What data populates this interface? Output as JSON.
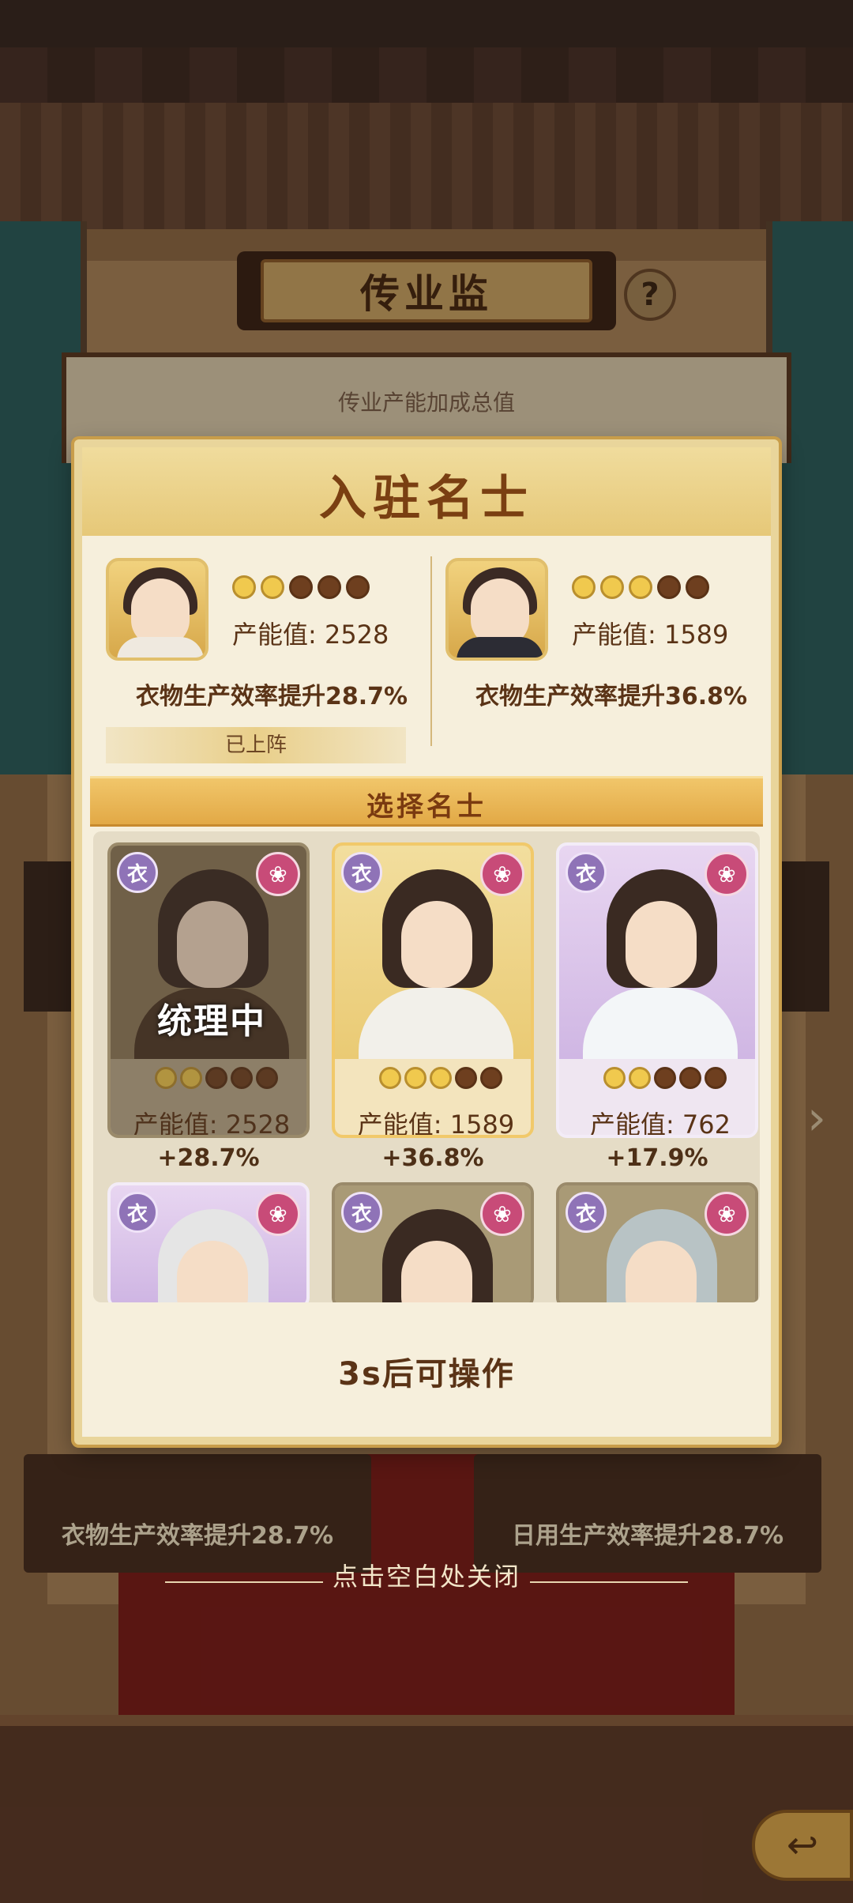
{
  "background": {
    "hall_title": "传业监",
    "help_label": "?",
    "panel_text": "传业产能加成总值",
    "bottom_left_text": "衣物生产效率提升28.7%",
    "bottom_right_text": "日用生产效率提升28.7%",
    "close_hint": "点击空白处关闭",
    "back_icon": "back-arrow-icon"
  },
  "modal": {
    "title": "入驻名士",
    "slots": [
      {
        "stars_on": 2,
        "stars_total": 5,
        "power": "产能值: 2528",
        "boost": "衣物生产效率提升28.7%",
        "status": "已上阵"
      },
      {
        "stars_on": 3,
        "stars_total": 5,
        "power": "产能值: 1589",
        "boost": "衣物生产效率提升36.8%"
      }
    ],
    "select_title": "选择名士",
    "cards": [
      {
        "type_tag": "衣",
        "stars_on": 2,
        "power": "产能值: 2528",
        "pct": "+28.7%",
        "status": "统理中"
      },
      {
        "type_tag": "衣",
        "stars_on": 3,
        "power": "产能值: 1589",
        "pct": "+36.8%"
      },
      {
        "type_tag": "衣",
        "stars_on": 2,
        "power": "产能值: 762",
        "pct": "+17.9%"
      },
      {
        "type_tag": "衣"
      },
      {
        "type_tag": "衣"
      },
      {
        "type_tag": "衣"
      }
    ],
    "wait_text": "3s后可操作"
  }
}
